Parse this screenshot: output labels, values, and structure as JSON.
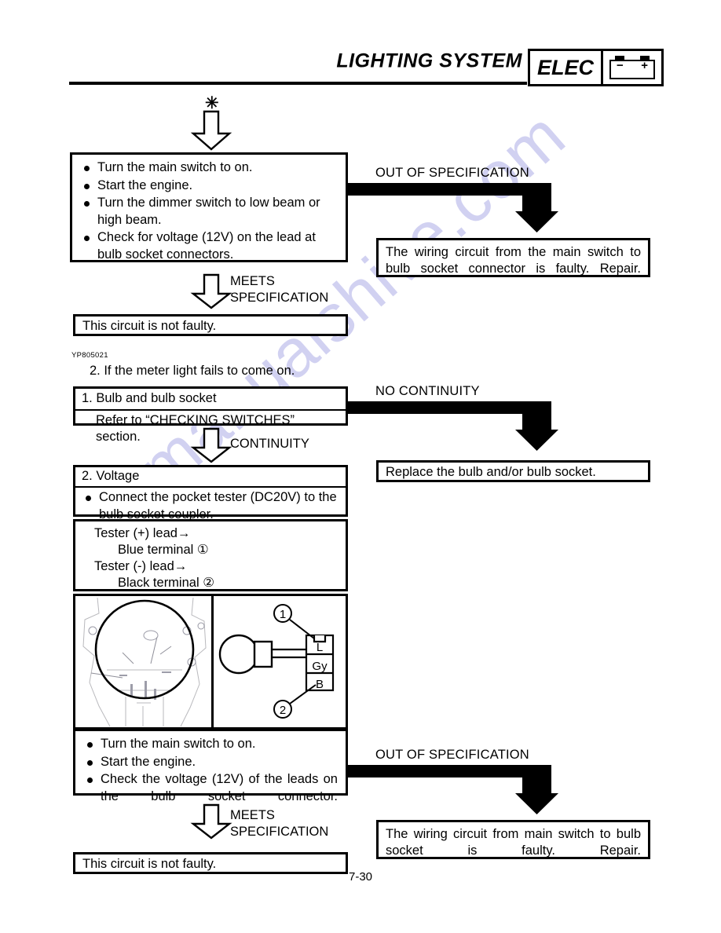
{
  "header": {
    "title": "LIGHTING SYSTEM",
    "badge_label": "ELEC",
    "battery_minus": "−",
    "battery_plus": "+"
  },
  "page_number": "7-30",
  "watermark": "manualshive.com",
  "section1": {
    "asterisk": "✳",
    "check_box": {
      "items": [
        "Turn the main switch to on.",
        "Start the engine.",
        "Turn the dimmer switch to low beam or high beam.",
        "Check for voltage (12V) on the lead at bulb socket connectors."
      ]
    },
    "out_of_spec_label": "OUT OF SPECIFICATION",
    "fault_box": "The wiring circuit from the main switch to bulb socket connector is faulty. Repair.",
    "meets_spec_label": "MEETS\nSPECIFICATION",
    "not_faulty_box": "This circuit is not faulty.",
    "figure_code": "YP805021"
  },
  "section2": {
    "heading": "2. If the meter light fails to come on.",
    "step1": {
      "title": "1. Bulb and bulb socket",
      "detail": "Refer to “CHECKING SWITCHES” section."
    },
    "no_continuity_label": "NO CONTINUITY",
    "replace_box": "Replace the bulb and/or bulb socket.",
    "continuity_label": "CONTINUITY",
    "step2": {
      "title": "2. Voltage",
      "bullets": [
        "Connect the pocket tester (DC20V) to the bulb socket coupler."
      ],
      "tester_lines": [
        "Tester (+) lead→",
        "Blue terminal ①",
        "Tester (-) lead→",
        "Black terminal ②"
      ]
    },
    "diagram": {
      "terminal_top": "L",
      "terminal_mid": "Gy",
      "terminal_bottom": "B",
      "callout_1": "1",
      "callout_2": "2"
    },
    "check_box": {
      "items": [
        "Turn the main switch to on.",
        "Start the engine.",
        "Check the voltage (12V) of the leads on the bulb socket connector."
      ]
    },
    "out_of_spec_label": "OUT OF SPECIFICATION",
    "fault_box": "The wiring circuit from main switch to bulb socket is faulty. Repair.",
    "meets_spec_label": "MEETS\nSPECIFICATION",
    "not_faulty_box": "This circuit is not faulty."
  }
}
